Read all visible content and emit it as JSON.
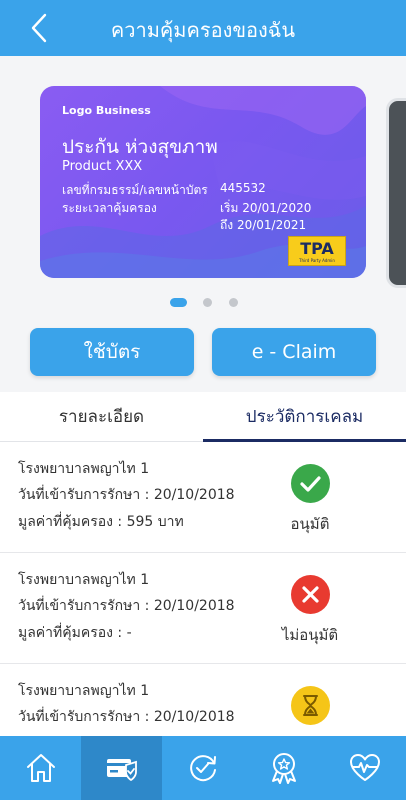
{
  "header": {
    "title": "ความคุ้มครองของฉัน",
    "back_icon": "chevron-left-icon"
  },
  "card": {
    "logo_text": "Logo Business",
    "insurance_name": "ประกัน ห่วงสุขภาพ",
    "product": "Product XXX",
    "policy_label": "เลขที่กรมธรรม์/เลขหน้าบัตร",
    "policy_number": "445532",
    "period_label": "ระยะเวลาคุ้มครอง",
    "period_start": "เริ่ม 20/01/2020",
    "period_end": "ถึง 20/01/2021",
    "badge_text": "TPA",
    "badge_subtext": "Third Party Admin",
    "gradient_start": "#8a5cf2",
    "gradient_end": "#6a5ce8"
  },
  "carousel": {
    "page_count": 3,
    "active_index": 0
  },
  "buttons": {
    "use_card": "ใช้บัตร",
    "e_claim": "e - Claim"
  },
  "tabs": [
    {
      "label": "รายละเอียด",
      "active": false
    },
    {
      "label": "ประวัติการเคลม",
      "active": true
    }
  ],
  "claims": [
    {
      "hospital": "โรงพยาบาลพญาไท 1",
      "admit_date": "วันที่เข้ารับการรักษา : 20/10/2018",
      "amount": "มูลค่าที่คุ้มครอง : 595 บาท",
      "status": "อนุมัติ",
      "status_icon": "check-circle-icon",
      "status_color": "#3aa84a"
    },
    {
      "hospital": "โรงพยาบาลพญาไท 1",
      "admit_date": "วันที่เข้ารับการรักษา : 20/10/2018",
      "amount": "มูลค่าที่คุ้มครอง : -",
      "status": "ไม่อนุมัติ",
      "status_icon": "x-circle-icon",
      "status_color": "#e83a30"
    },
    {
      "hospital": "โรงพยาบาลพญาไท 1",
      "admit_date": "วันที่เข้ารับการรักษา : 20/10/2018",
      "amount": "",
      "status": "",
      "status_icon": "hourglass-circle-icon",
      "status_color": "#f5c518"
    }
  ],
  "bottom_nav": [
    {
      "icon": "home-icon",
      "active": false
    },
    {
      "icon": "insurance-card-check-icon",
      "active": true
    },
    {
      "icon": "refresh-check-icon",
      "active": false
    },
    {
      "icon": "award-ribbon-icon",
      "active": false
    },
    {
      "icon": "heart-pulse-icon",
      "active": false
    }
  ],
  "colors": {
    "primary": "#3aa3ea",
    "primary_dark": "#2e88c9",
    "tab_active": "#1b2b63"
  }
}
